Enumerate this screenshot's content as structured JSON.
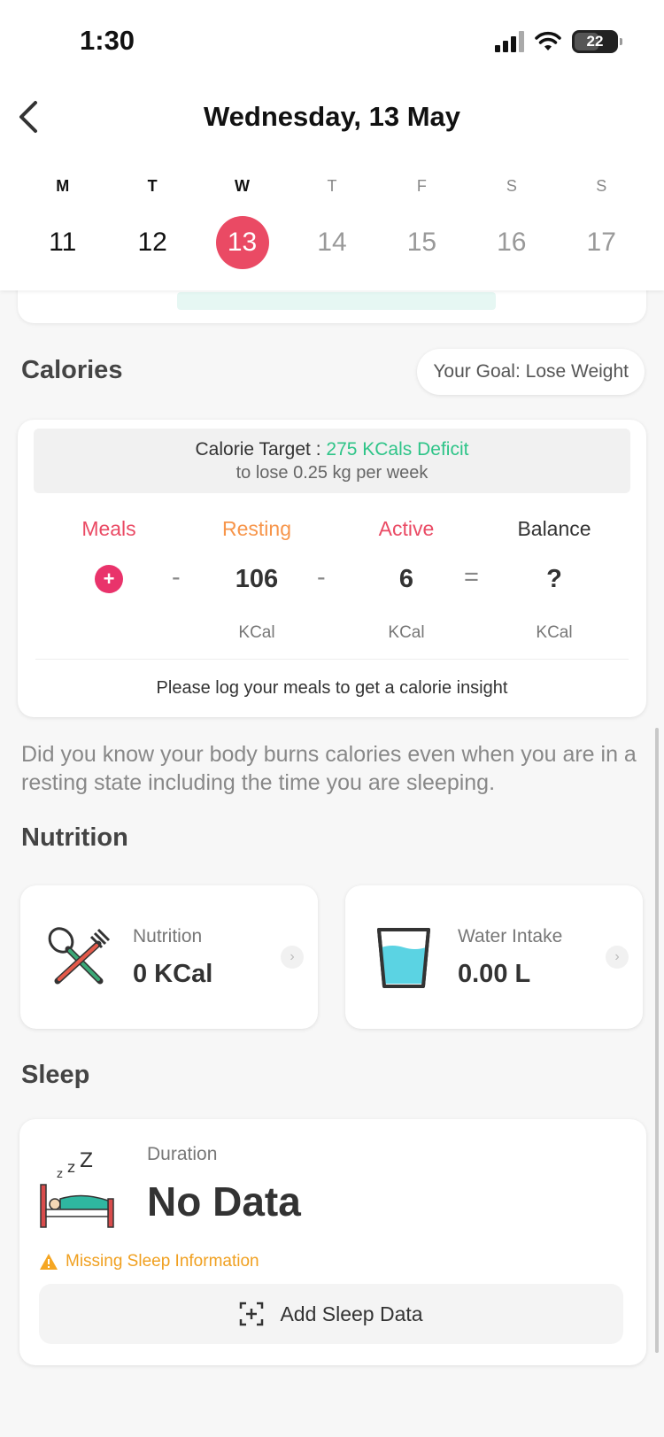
{
  "status": {
    "time": "1:30",
    "battery": "22"
  },
  "header": {
    "title": "Wednesday, 13 May"
  },
  "week": [
    {
      "letter": "M",
      "num": "11"
    },
    {
      "letter": "T",
      "num": "12"
    },
    {
      "letter": "W",
      "num": "13"
    },
    {
      "letter": "T",
      "num": "14"
    },
    {
      "letter": "F",
      "num": "15"
    },
    {
      "letter": "S",
      "num": "16"
    },
    {
      "letter": "S",
      "num": "17"
    }
  ],
  "calories": {
    "title": "Calories",
    "goal_pill": "Your Goal: Lose Weight",
    "target_prefix": "Calorie Target :",
    "target_value": "275 KCals Deficit",
    "target_sub": "to lose 0.25 kg per week",
    "labels": {
      "meals": "Meals",
      "resting": "Resting",
      "active": "Active",
      "balance": "Balance"
    },
    "values": {
      "resting": "106",
      "active": "6",
      "balance": "?"
    },
    "ops": {
      "minus": "-",
      "equals": "="
    },
    "unit": "KCal",
    "insight": "Please log your meals to get a calorie insight",
    "colors": {
      "meals": "#ea4a64",
      "resting": "#f7954a",
      "active": "#ea4a64",
      "balance": "#333333",
      "accent": "#2ec488"
    }
  },
  "tip": "Did you know your body burns calories even when you are in a resting state including the time you are sleeping.",
  "nutrition": {
    "title": "Nutrition",
    "cards": [
      {
        "label": "Nutrition",
        "value": "0 KCal",
        "icon": "utensils-icon"
      },
      {
        "label": "Water Intake",
        "value": "0.00 L",
        "icon": "water-glass-icon"
      }
    ]
  },
  "sleep": {
    "title": "Sleep",
    "duration_label": "Duration",
    "duration_value": "No Data",
    "missing": "Missing Sleep Information",
    "add_button": "Add Sleep Data"
  }
}
